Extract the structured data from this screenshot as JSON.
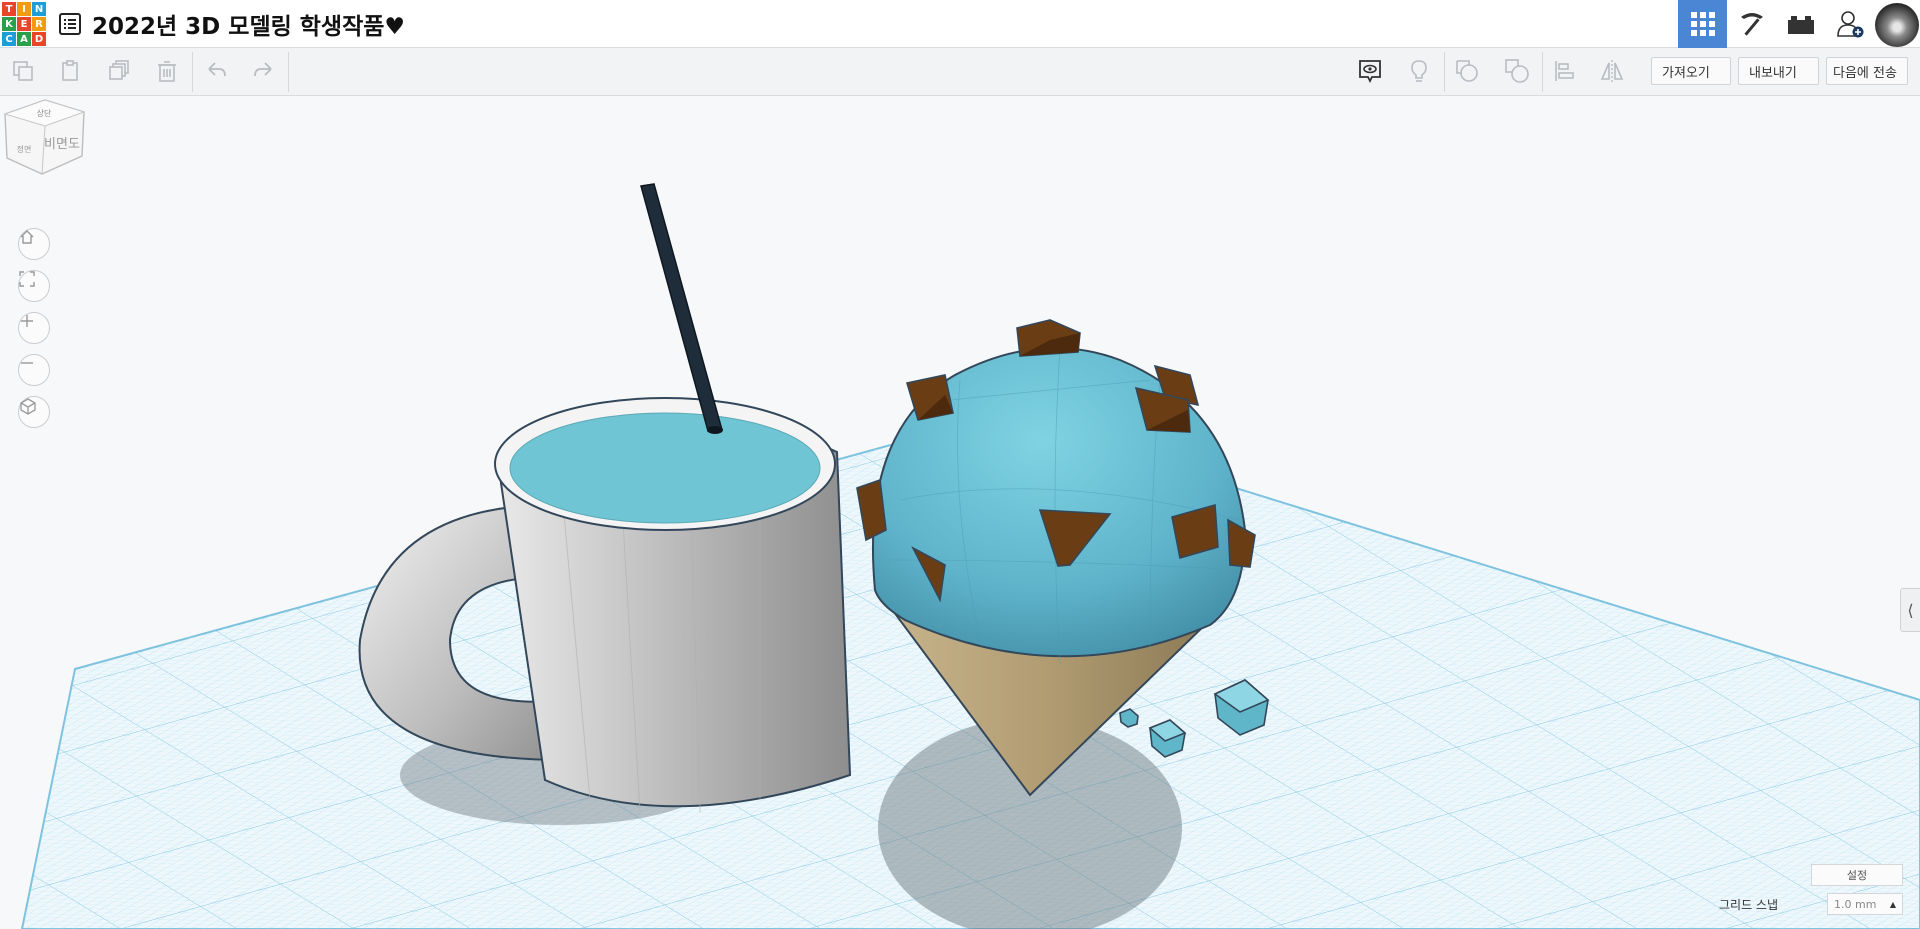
{
  "app": {
    "logo_letters": [
      "T",
      "I",
      "N",
      "K",
      "E",
      "R",
      "C",
      "A",
      "D"
    ],
    "logo_colors": [
      "#e8462a",
      "#f39c12",
      "#1d9dd9",
      "#2aa04a",
      "#e8462a",
      "#f39c12",
      "#1d9dd9",
      "#2aa04a",
      "#e8462a"
    ],
    "title": "2022년 3D 모델링 학생작품♥"
  },
  "topbar": {
    "icons": [
      "grid-view-icon",
      "pickaxe-icon",
      "bricks-icon",
      "add-user-icon"
    ],
    "accent": "#4b86d4"
  },
  "toolbar": {
    "import_label": "가져오기",
    "export_label": "내보내기",
    "send_label": "다음에 전송"
  },
  "viewcube": {
    "top_label": "상단",
    "front_label": "정면",
    "face_label": "비면도"
  },
  "nav": [
    "home-icon",
    "fit-view-icon",
    "zoom-in-icon",
    "zoom-out-icon",
    "perspective-icon"
  ],
  "footer": {
    "settings_label": "설정",
    "grid_snap_label": "그리드 스냅",
    "grid_snap_value": "1.0 mm"
  }
}
